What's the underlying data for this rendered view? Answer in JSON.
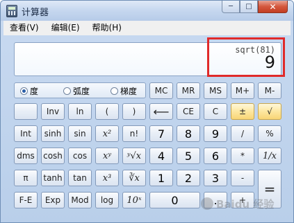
{
  "window": {
    "title": "计算器"
  },
  "titlebar_buttons": {
    "minimize": "─",
    "maximize": "□",
    "close": "✕"
  },
  "menu": {
    "items": [
      "查看(V)",
      "编辑(E)",
      "帮助(H)"
    ]
  },
  "display": {
    "expression": "sqrt(81)",
    "value": "9"
  },
  "mode": {
    "selected": "度",
    "options": [
      "度",
      "弧度",
      "梯度"
    ]
  },
  "keys": {
    "mc": "MC",
    "mr": "MR",
    "ms": "MS",
    "mplus": "M+",
    "mminus": "M-",
    "blank": "",
    "inv": "Inv",
    "ln": "ln",
    "lparen": "(",
    "rparen": ")",
    "backspace": "⟵",
    "ce": "CE",
    "c": "C",
    "plusminus": "±",
    "sqrt": "√",
    "int": "Int",
    "sinh": "sinh",
    "sin": "sin",
    "x2": "x²",
    "nfact": "n!",
    "seven": "7",
    "eight": "8",
    "nine": "9",
    "div": "/",
    "pct": "%",
    "dms": "dms",
    "cosh": "cosh",
    "cos": "cos",
    "xy": "xʸ",
    "yroot": "ʸ√x",
    "four": "4",
    "five": "5",
    "six": "6",
    "mul": "*",
    "recip": "1/x",
    "pi": "π",
    "tanh": "tanh",
    "tan": "tan",
    "x3": "x³",
    "cuberoot": "∛x",
    "one": "1",
    "two": "2",
    "three": "3",
    "minus": "-",
    "equals": "=",
    "fe": "F-E",
    "exp": "Exp",
    "mod": "Mod",
    "log": "log",
    "tenx": "10ˣ",
    "zero": "0",
    "dot": ".",
    "plus": "+"
  },
  "watermark": {
    "text": "Baidu 经验"
  }
}
